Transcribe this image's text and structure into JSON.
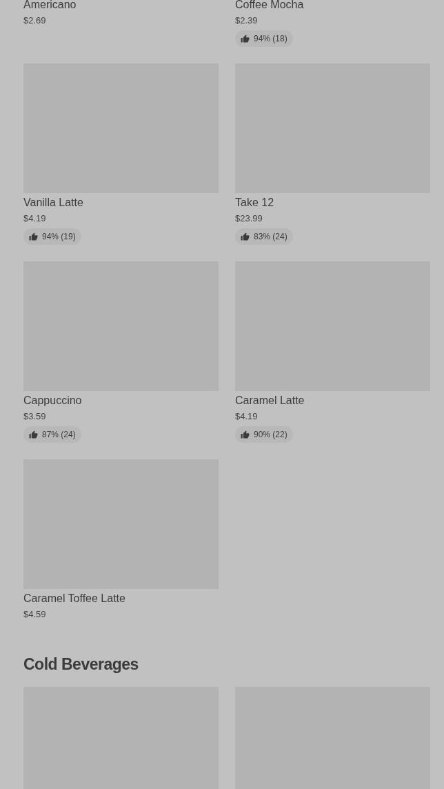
{
  "sections": [
    {
      "items": [
        {
          "kind": "text_only",
          "name": "Americano",
          "price": "$2.69"
        },
        {
          "kind": "text_only",
          "name": "Coffee Mocha",
          "price": "$2.39",
          "rating": "94% (18)"
        },
        {
          "kind": "product",
          "name": "Vanilla Latte",
          "price": "$4.19",
          "rating": "94% (19)"
        },
        {
          "kind": "product",
          "name": "Take 12",
          "price": "$23.99",
          "rating": "83% (24)"
        },
        {
          "kind": "product",
          "name": "Cappuccino",
          "price": "$3.59",
          "rating": "87% (24)"
        },
        {
          "kind": "product",
          "name": "Caramel Latte",
          "price": "$4.19",
          "rating": "90% (22)"
        },
        {
          "kind": "product",
          "name": "Caramel Toffee Latte",
          "price": "$4.59"
        }
      ]
    },
    {
      "title": "Cold Beverages"
    }
  ]
}
